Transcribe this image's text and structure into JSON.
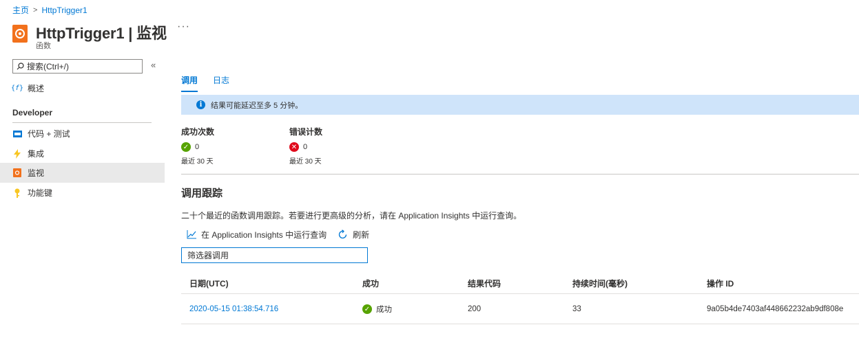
{
  "breadcrumb": {
    "home": "主页",
    "current": "HttpTrigger1"
  },
  "header": {
    "title": "HttpTrigger1 | 监视",
    "subtitle": "函数",
    "more": "···",
    "icon": "function-app-icon"
  },
  "sidebar": {
    "search_placeholder": "搜索(Ctrl+/)",
    "collapse": "«",
    "overview": "概述",
    "section": "Developer",
    "items": [
      {
        "label": "代码 + 测试",
        "icon": "code-test-icon",
        "color": "#0078d4"
      },
      {
        "label": "集成",
        "icon": "lightning-icon",
        "color": "#f8c624"
      },
      {
        "label": "监视",
        "icon": "monitor-icon",
        "color": "#f2711c",
        "active": true
      },
      {
        "label": "功能键",
        "icon": "key-icon",
        "color": "#f8c624"
      }
    ]
  },
  "tabs": [
    {
      "label": "调用",
      "active": true
    },
    {
      "label": "日志",
      "active": false
    }
  ],
  "banner": {
    "text": "结果可能延迟至多 5 分钟。"
  },
  "stats": {
    "success": {
      "label": "成功次数",
      "value": "0",
      "period": "最近 30 天"
    },
    "errors": {
      "label": "错误计数",
      "value": "0",
      "period": "最近 30 天"
    }
  },
  "traces": {
    "title": "调用跟踪",
    "description": "二十个最近的函数调用跟踪。若要进行更高级的分析，请在 Application Insights 中运行查询。",
    "run_query": "在 Application Insights 中运行查询",
    "refresh": "刷新",
    "filter_placeholder": "筛选器调用"
  },
  "table": {
    "headers": [
      "日期(UTC)",
      "成功",
      "结果代码",
      "持续时间(毫秒)",
      "操作 ID"
    ],
    "rows": [
      [
        "2020-05-15 01:38:54.716",
        "成功",
        "200",
        "33",
        "9a05b4de7403af448662232ab9df808e"
      ]
    ]
  },
  "colors": {
    "accent": "#0078d4",
    "banner_bg": "#cfe4fa",
    "success": "#57a300",
    "error": "#e00b1c"
  }
}
